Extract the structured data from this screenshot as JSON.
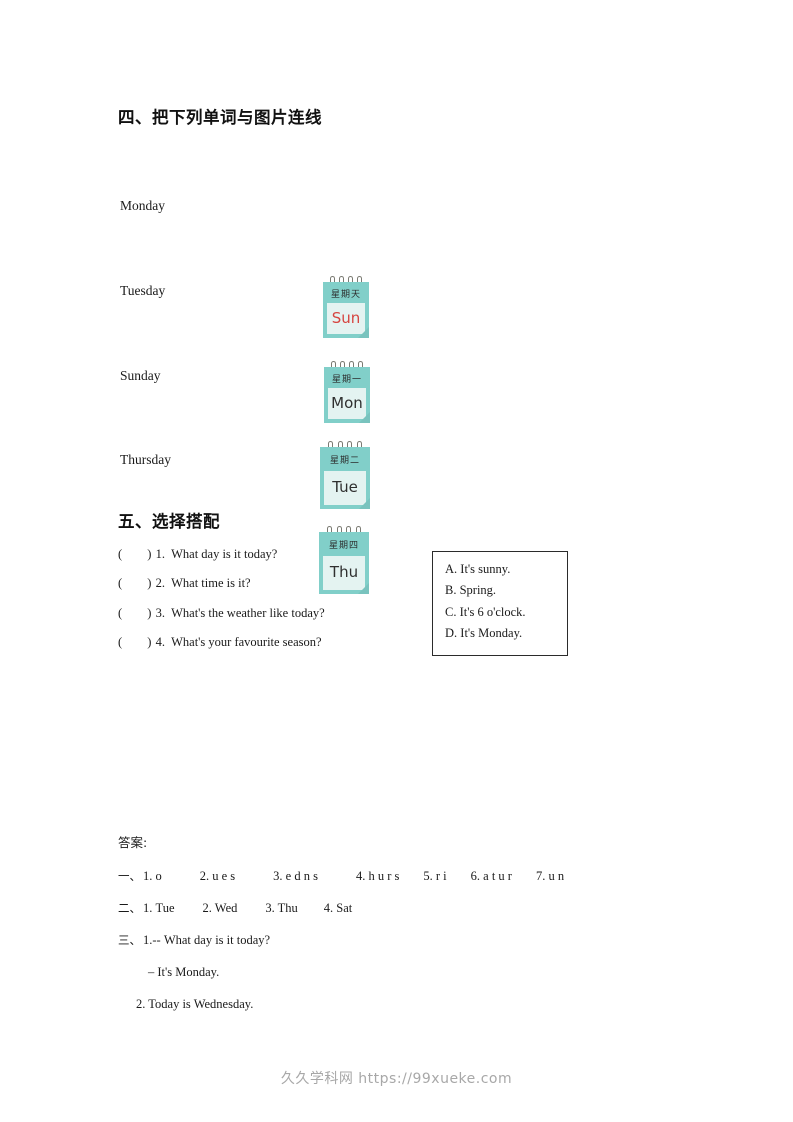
{
  "document": {
    "type": "worksheet"
  },
  "section_four": {
    "heading": "四、把下列单词与图片连线",
    "words": [
      {
        "label": "Monday"
      },
      {
        "label": "Tuesday"
      },
      {
        "label": "Sunday"
      },
      {
        "label": "Thursday"
      }
    ],
    "calendars": [
      {
        "chinese": "星期天",
        "abbr": "Sun",
        "accent": true
      },
      {
        "chinese": "星期一",
        "abbr": "Mon",
        "accent": false
      },
      {
        "chinese": "星期二",
        "abbr": "Tue",
        "accent": false
      },
      {
        "chinese": "星期四",
        "abbr": "Thu",
        "accent": false
      }
    ]
  },
  "section_five": {
    "heading": "五、选择搭配",
    "questions": [
      {
        "bracket": "(",
        "bracket_close": ")",
        "number": "1.",
        "text": "What day is it today?"
      },
      {
        "bracket": "(",
        "bracket_close": ")",
        "number": "2.",
        "text": "What time is it?"
      },
      {
        "bracket": "(",
        "bracket_close": ")",
        "number": "3.",
        "text": "What's the weather like today?"
      },
      {
        "bracket": "(",
        "bracket_close": ")",
        "number": "4.",
        "text": "What's your favourite season?"
      }
    ],
    "options": [
      "A. It's sunny.",
      "B. Spring.",
      "C. It's 6 o'clock.",
      "D. It's Monday."
    ]
  },
  "answer_key": {
    "title": "答案:",
    "line_one_label": "一、",
    "line_one_items": [
      "1. o",
      "2. u e s",
      "3. e d n s",
      "4. h u r s",
      "5. r i",
      "6. a t u r",
      "7. u n"
    ],
    "line_two_label": "二、",
    "line_two_items": [
      "1. Tue",
      "2. Wed",
      "3. Thu",
      "4. Sat"
    ],
    "line_three_label": "三、",
    "line_three_text": "1.-- What day is it today?",
    "line_three_reply": "– It's Monday.",
    "line_four_text": "2. Today is Wednesday."
  },
  "footer": {
    "watermark": "久久学科网 https://99xueke.com"
  },
  "colors": {
    "calendar_header": "#81cfc9",
    "calendar_body": "#e4f3f1",
    "accent_text": "#d6443f",
    "watermark": "#a8a8a8"
  }
}
